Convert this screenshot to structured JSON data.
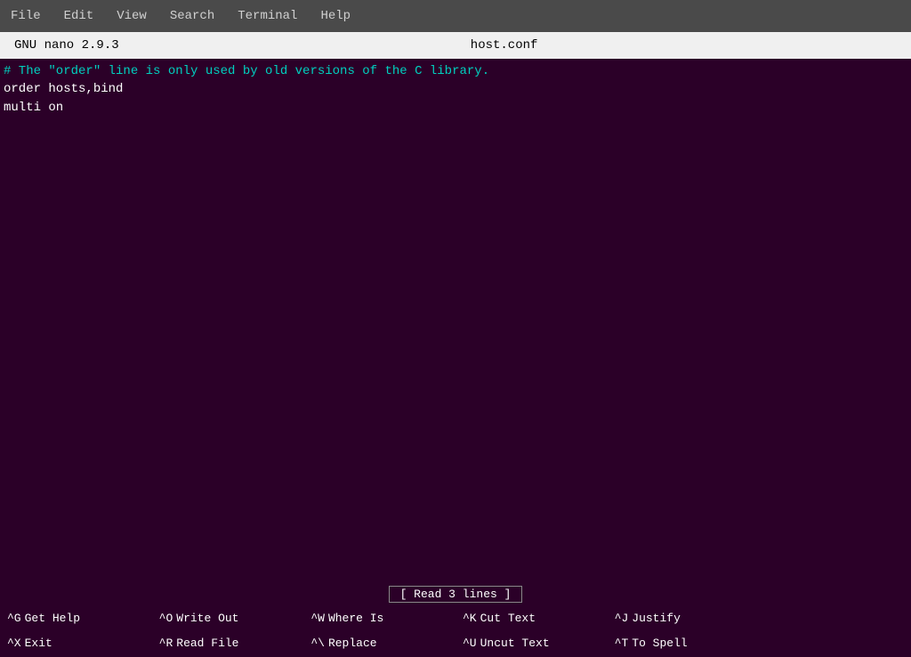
{
  "menubar": {
    "items": [
      "File",
      "Edit",
      "View",
      "Search",
      "Terminal",
      "Help"
    ]
  },
  "titlebar": {
    "app": "GNU nano 2.9.3",
    "filename": "host.conf"
  },
  "editor": {
    "lines": [
      {
        "type": "comment",
        "text": "# The \"order\" line is only used by old versions of the C library."
      },
      {
        "type": "normal",
        "text": "order hosts,bind"
      },
      {
        "type": "normal",
        "text": "multi on"
      }
    ]
  },
  "status": {
    "message": "[ Read 3 lines ]"
  },
  "shortcuts": [
    {
      "key": "^G",
      "label": "Get Help"
    },
    {
      "key": "^O",
      "label": "Write Out"
    },
    {
      "key": "^W",
      "label": "Where Is"
    },
    {
      "key": "^K",
      "label": "Cut Text"
    },
    {
      "key": "^J",
      "label": "Justify"
    },
    {
      "key": "^X",
      "label": "Exit"
    },
    {
      "key": "^R",
      "label": "Read File"
    },
    {
      "key": "^\\",
      "label": "Replace"
    },
    {
      "key": "^U",
      "label": "Uncut Text"
    },
    {
      "key": "^T",
      "label": "To Spell"
    }
  ]
}
